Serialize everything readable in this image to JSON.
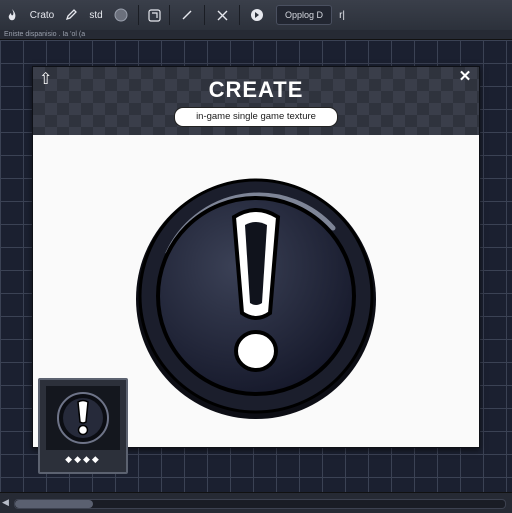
{
  "toolbar": {
    "app_label": "Crato",
    "mode_label": "std",
    "dropdown_label": "Opplog D",
    "extra_label": "r|"
  },
  "subbar": {
    "text": "Eniste dispanisio . Ia 'ol (a"
  },
  "dialog": {
    "title": "CREATE",
    "subtitle": "in-game single game texture",
    "close_symbol": "✕",
    "drag_symbol": "⇧"
  },
  "thumbnail": {
    "dots": "◆◆◆◆"
  },
  "status": {
    "scroll_fraction": 0.16
  },
  "icons": {
    "app": "flame-icon",
    "pen": "pen-icon",
    "circle": "circle-icon",
    "layers": "layers-icon",
    "brush": "brush-icon",
    "close": "close-icon",
    "pin": "pin-icon",
    "warning": "exclamation-icon"
  },
  "colors": {
    "warning_fill": "#2a2e40",
    "accent": "#ffffff"
  }
}
